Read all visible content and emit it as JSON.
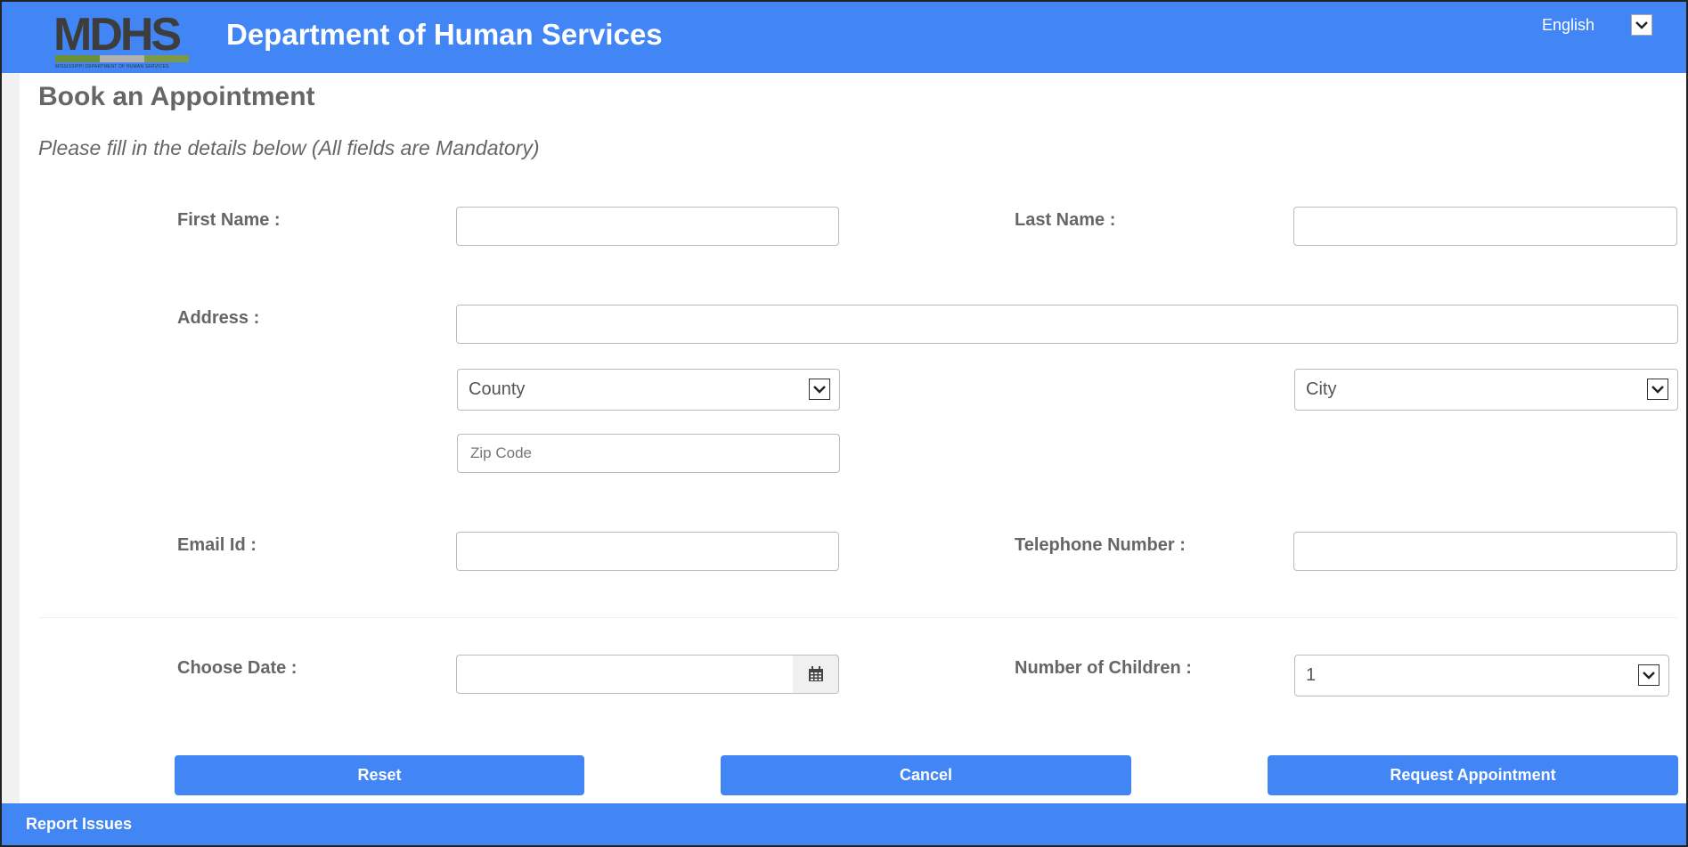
{
  "header": {
    "logo_text": "MDHS",
    "logo_subtext": "MISSISSIPPI DEPARTMENT OF HUMAN SERVICES",
    "title": "Department of Human Services",
    "language": "English",
    "brand_color": "#4285f4"
  },
  "page": {
    "title": "Book an Appointment",
    "subtitle": "Please fill in the details below (All fields are Mandatory)"
  },
  "form": {
    "first_name_label": "First Name :",
    "first_name_value": "",
    "last_name_label": "Last Name :",
    "last_name_value": "",
    "address_label": "Address :",
    "address_value": "",
    "county_value": "County",
    "city_value": "City",
    "zip_placeholder": "Zip Code",
    "email_label": "Email Id :",
    "email_value": "",
    "telephone_label": "Telephone Number :",
    "telephone_value": "",
    "date_label": "Choose Date :",
    "date_value": "",
    "children_label": "Number of Children :",
    "children_value": "1"
  },
  "actions": {
    "reset": "Reset",
    "cancel": "Cancel",
    "request": "Request Appointment"
  },
  "footer": {
    "report_issues": "Report Issues"
  },
  "icons": {
    "dropdown": "chevron-down-icon",
    "calendar": "calendar-icon"
  }
}
